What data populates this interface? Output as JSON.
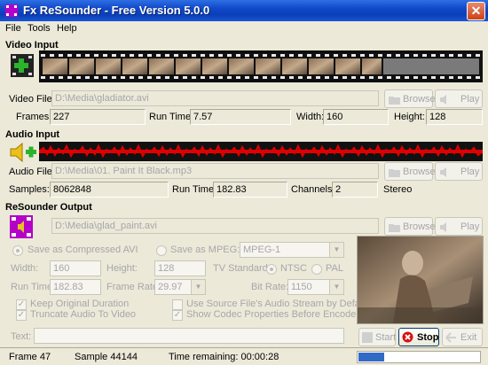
{
  "app": {
    "title": "Fx ReSounder - Free Version 5.0.0"
  },
  "menu": [
    "File",
    "Tools",
    "Help"
  ],
  "video": {
    "section_title": "Video Input",
    "file_label": "Video File:",
    "file_value": "D:\\Media\\gladiator.avi",
    "frames_label": "Frames:",
    "frames_value": "227",
    "runtime_label": "Run Time:",
    "runtime_value": "7.57",
    "width_label": "Width:",
    "width_value": "160",
    "height_label": "Height:",
    "height_value": "128",
    "browse_label": "Browse",
    "play_label": "Play"
  },
  "audio": {
    "section_title": "Audio Input",
    "file_label": "Audio File:",
    "file_value": "D:\\Media\\01. Paint It Black.mp3",
    "samples_label": "Samples:",
    "samples_value": "8062848",
    "runtime_label": "Run Time:",
    "runtime_value": "182.83",
    "channels_label": "Channels:",
    "channels_value": "2",
    "mode_value": "Stereo",
    "browse_label": "Browse",
    "play_label": "Play"
  },
  "output": {
    "section_title": "ReSounder Output",
    "file_value": "D:\\Media\\glad_paint.avi",
    "browse_label": "Browse",
    "play_label": "Play",
    "save_avi_label": "Save as Compressed AVI",
    "save_mpeg_label": "Save as MPEG:",
    "mpeg_format": "MPEG-1",
    "width_label": "Width:",
    "width_value": "160",
    "height_label": "Height:",
    "height_value": "128",
    "tv_standard_label": "TV Standard:",
    "ntsc_label": "NTSC",
    "pal_label": "PAL",
    "runtime_label": "Run Time:",
    "runtime_value": "182.83",
    "framerate_label": "Frame Rate:",
    "framerate_value": "29.97",
    "bitrate_label": "Bit Rate:",
    "bitrate_value": "1150",
    "keep_duration_label": "Keep Original Duration",
    "truncate_audio_label": "Truncate Audio To Video",
    "use_source_audio_label": "Use Source File's Audio Stream by Default",
    "show_codec_label": "Show Codec Properties Before Encode",
    "text_label": "Text:",
    "text_value": ""
  },
  "actions": {
    "start_label": "Start",
    "stop_label": "Stop",
    "exit_label": "Exit"
  },
  "status": {
    "frame": "Frame 47",
    "sample": "Sample 44144",
    "time_remaining": "Time remaining: 00:00:28",
    "progress": 0.21
  },
  "colors": {
    "titlebar": "#0a3fb8",
    "waveform": "#e00000",
    "progress": "#316ac5",
    "accent_green": "#2bb32b"
  }
}
